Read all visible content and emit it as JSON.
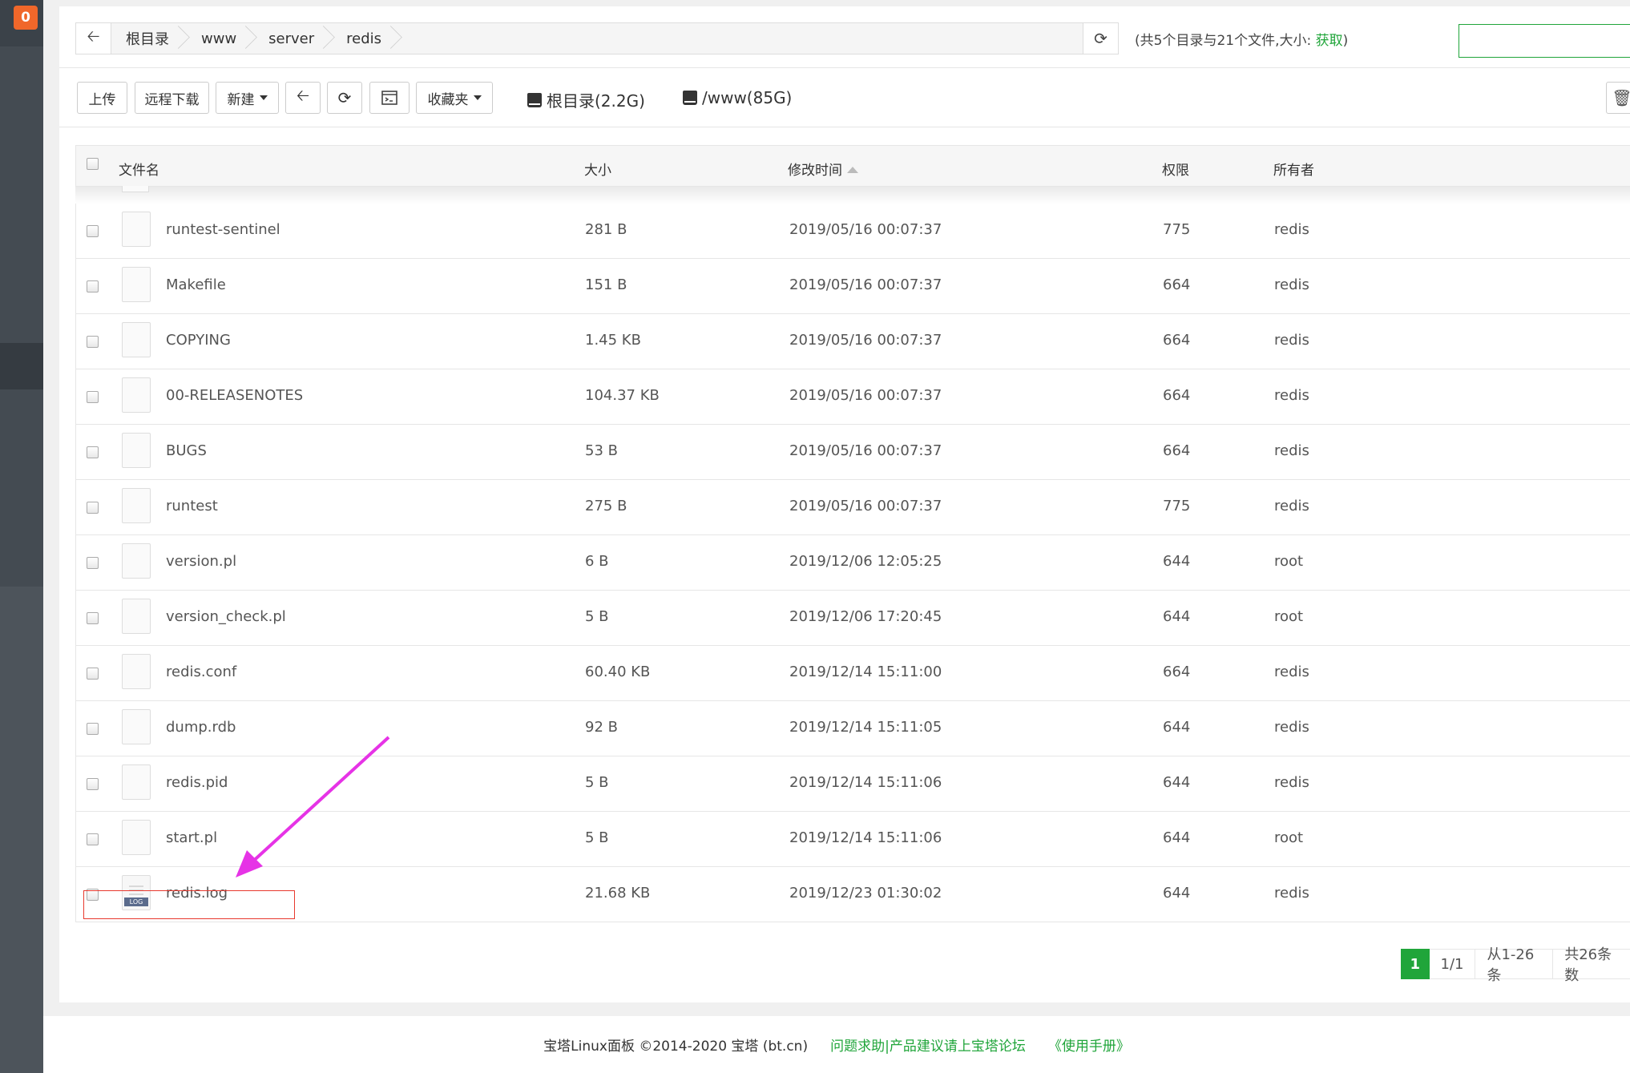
{
  "sidebar": {
    "badge": "0"
  },
  "path": {
    "crumbs": [
      "根目录",
      "www",
      "server",
      "redis"
    ],
    "summary_prefix": "(共5个目录与21个文件,大小:",
    "summary_link": "获取",
    "summary_suffix": ")"
  },
  "toolbar": {
    "upload": "上传",
    "remote_download": "远程下载",
    "new": "新建",
    "favorites": "收藏夹",
    "disk_root": "根目录(2.2G)",
    "disk_www": "/www(85G)"
  },
  "table": {
    "headers": {
      "name": "文件名",
      "size": "大小",
      "modified": "修改时间",
      "permission": "权限",
      "owner": "所有者"
    },
    "rows": [
      {
        "name": "runtest-sentinel",
        "size": "281 B",
        "modified": "2019/05/16 00:07:37",
        "permission": "775",
        "owner": "redis"
      },
      {
        "name": "Makefile",
        "size": "151 B",
        "modified": "2019/05/16 00:07:37",
        "permission": "664",
        "owner": "redis"
      },
      {
        "name": "COPYING",
        "size": "1.45 KB",
        "modified": "2019/05/16 00:07:37",
        "permission": "664",
        "owner": "redis"
      },
      {
        "name": "00-RELEASENOTES",
        "size": "104.37 KB",
        "modified": "2019/05/16 00:07:37",
        "permission": "664",
        "owner": "redis"
      },
      {
        "name": "BUGS",
        "size": "53 B",
        "modified": "2019/05/16 00:07:37",
        "permission": "664",
        "owner": "redis"
      },
      {
        "name": "runtest",
        "size": "275 B",
        "modified": "2019/05/16 00:07:37",
        "permission": "775",
        "owner": "redis"
      },
      {
        "name": "version.pl",
        "size": "6 B",
        "modified": "2019/12/06 12:05:25",
        "permission": "644",
        "owner": "root"
      },
      {
        "name": "version_check.pl",
        "size": "5 B",
        "modified": "2019/12/06 17:20:45",
        "permission": "644",
        "owner": "root"
      },
      {
        "name": "redis.conf",
        "size": "60.40 KB",
        "modified": "2019/12/14 15:11:00",
        "permission": "664",
        "owner": "redis"
      },
      {
        "name": "dump.rdb",
        "size": "92 B",
        "modified": "2019/12/14 15:11:05",
        "permission": "644",
        "owner": "redis"
      },
      {
        "name": "redis.pid",
        "size": "5 B",
        "modified": "2019/12/14 15:11:06",
        "permission": "644",
        "owner": "redis"
      },
      {
        "name": "start.pl",
        "size": "5 B",
        "modified": "2019/12/14 15:11:06",
        "permission": "644",
        "owner": "root"
      },
      {
        "name": "redis.log",
        "size": "21.68 KB",
        "modified": "2019/12/23 01:30:02",
        "permission": "644",
        "owner": "redis",
        "tag": "LOG"
      }
    ]
  },
  "pagination": {
    "current": "1",
    "pages": "1/1",
    "range": "从1-26条",
    "total": "共26条数"
  },
  "footer": {
    "copyright": "宝塔Linux面板 ©2014-2020 宝塔 (bt.cn)",
    "forum": "问题求助|产品建议请上宝塔论坛",
    "manual": "《使用手册》"
  },
  "colors": {
    "accent": "#20a53a",
    "badge": "#f0672a",
    "highlight": "#e8392e",
    "arrow": "#e633e6"
  }
}
